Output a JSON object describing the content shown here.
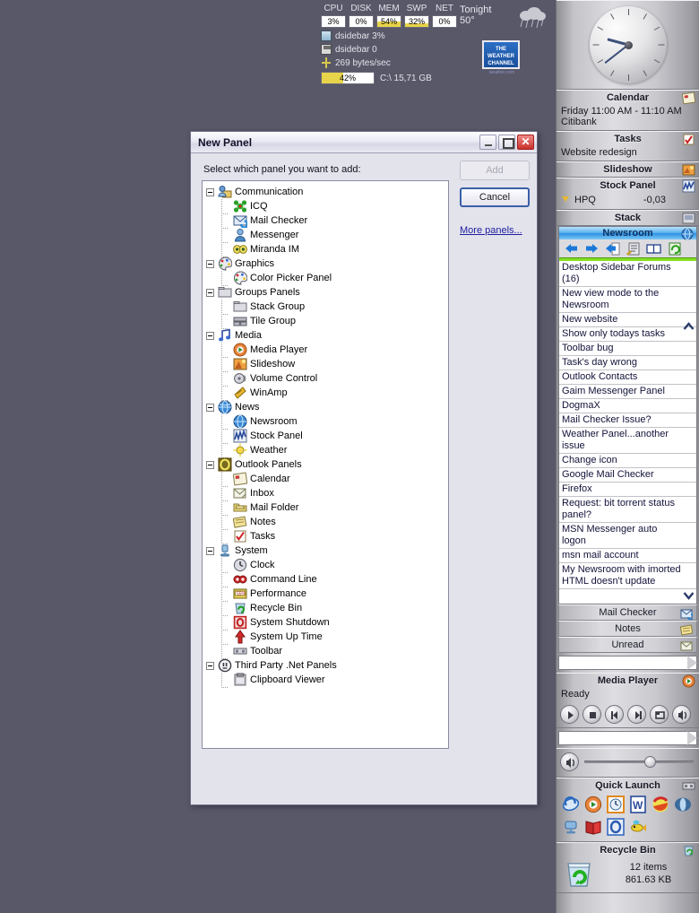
{
  "desktop": {
    "background": "#585869"
  },
  "sysmon": {
    "labels": [
      "CPU",
      "DISK",
      "MEM",
      "SWP",
      "NET"
    ],
    "values": [
      "3%",
      "0%",
      "54%",
      "32%",
      "0%"
    ],
    "fills": [
      0,
      0,
      54,
      32,
      0
    ],
    "cpu_process": "dsidebar 3%",
    "disk_process": "dsidebar 0",
    "net_rate": "269 bytes/sec",
    "drive_percent": "42%",
    "drive_fill": 42,
    "drive_label": "C:\\ 15,71 GB"
  },
  "weather": {
    "when": "Tonight",
    "temp": "50°",
    "brand_line1": "THE",
    "brand_line2": "WEATHER",
    "brand_line3": "CHANNEL",
    "brand_sub": "weather.com"
  },
  "dialog": {
    "title": "New Panel",
    "prompt": "Select which panel you want to add:",
    "buttons": {
      "add": "Add",
      "cancel": "Cancel",
      "more": "More panels..."
    },
    "window_controls": {
      "minimize": "minimize-button",
      "maximize": "maximize-button",
      "close": "✕"
    },
    "tree": [
      {
        "label": "Communication",
        "icon": "communication-icon",
        "group": true,
        "children": [
          {
            "label": "ICQ",
            "icon": "icq-icon"
          },
          {
            "label": "Mail Checker",
            "icon": "mail-checker-icon"
          },
          {
            "label": "Messenger",
            "icon": "messenger-icon"
          },
          {
            "label": "Miranda IM",
            "icon": "miranda-im-icon"
          }
        ]
      },
      {
        "label": "Graphics",
        "icon": "graphics-icon",
        "group": true,
        "children": [
          {
            "label": "Color Picker Panel",
            "icon": "color-picker-icon"
          }
        ]
      },
      {
        "label": "Groups Panels",
        "icon": "groups-icon",
        "group": true,
        "children": [
          {
            "label": "Stack Group",
            "icon": "stack-group-icon"
          },
          {
            "label": "Tile Group",
            "icon": "tile-group-icon"
          }
        ]
      },
      {
        "label": "Media",
        "icon": "media-icon",
        "group": true,
        "children": [
          {
            "label": "Media Player",
            "icon": "media-player-icon"
          },
          {
            "label": "Slideshow",
            "icon": "slideshow-icon"
          },
          {
            "label": "Volume Control",
            "icon": "volume-control-icon"
          },
          {
            "label": "WinAmp",
            "icon": "winamp-icon"
          }
        ]
      },
      {
        "label": "News",
        "icon": "news-icon",
        "group": true,
        "children": [
          {
            "label": "Newsroom",
            "icon": "newsroom-icon"
          },
          {
            "label": "Stock Panel",
            "icon": "stock-panel-icon"
          },
          {
            "label": "Weather",
            "icon": "weather-icon"
          }
        ]
      },
      {
        "label": "Outlook Panels",
        "icon": "outlook-icon",
        "group": true,
        "children": [
          {
            "label": "Calendar",
            "icon": "calendar-icon"
          },
          {
            "label": "Inbox",
            "icon": "inbox-icon"
          },
          {
            "label": "Mail Folder",
            "icon": "mail-folder-icon"
          },
          {
            "label": "Notes",
            "icon": "notes-icon"
          },
          {
            "label": "Tasks",
            "icon": "tasks-icon"
          }
        ]
      },
      {
        "label": "System",
        "icon": "system-icon",
        "group": true,
        "children": [
          {
            "label": "Clock",
            "icon": "clock-icon"
          },
          {
            "label": "Command Line",
            "icon": "command-line-icon"
          },
          {
            "label": "Performance",
            "icon": "performance-icon"
          },
          {
            "label": "Recycle Bin",
            "icon": "recycle-bin-icon"
          },
          {
            "label": "System Shutdown",
            "icon": "system-shutdown-icon"
          },
          {
            "label": "System Up Time",
            "icon": "system-uptime-icon"
          },
          {
            "label": "Toolbar",
            "icon": "toolbar-icon"
          }
        ]
      },
      {
        "label": "Third Party .Net Panels",
        "icon": "third-party-icon",
        "group": true,
        "children": [
          {
            "label": "Clipboard Viewer",
            "icon": "clipboard-viewer-icon"
          }
        ]
      }
    ]
  },
  "sidebar": {
    "clock": {
      "name": "Clock",
      "hour_angle": 285,
      "minute_angle": 232
    },
    "calendar": {
      "title": "Calendar",
      "line1": "Friday 11:00 AM - 11:10 AM",
      "line2": "Citibank"
    },
    "tasks": {
      "title": "Tasks",
      "item": "Website redesign"
    },
    "slideshow": {
      "title": "Slideshow"
    },
    "stock": {
      "title": "Stock Panel",
      "symbol": "HPQ",
      "change": "-0,03"
    },
    "stack": {
      "title": "Stack"
    },
    "newsroom": {
      "title": "Newsroom",
      "tools": [
        "back-icon",
        "forward-icon",
        "new-post-icon",
        "edit-icon",
        "read-icon",
        "refresh-icon"
      ],
      "items": [
        "Desktop Sidebar Forums (16)",
        "New view mode to the Newsroom",
        "New website",
        "Show only todays tasks",
        "Toolbar bug",
        "Task's day wrong",
        "Outlook Contacts",
        "Gaim Messenger Panel",
        "DogmaX",
        "Mail Checker Issue?",
        "Weather Panel...another issue",
        "Change icon",
        "Google Mail Checker",
        "Firefox",
        "Request: bit torrent status panel?",
        "MSN Messenger auto logon",
        "msn mail account",
        "My Newsroom with imorted HTML doesn't update"
      ],
      "buttons": [
        "Mail Checker",
        "Notes",
        "Unread"
      ]
    },
    "mediaplayer": {
      "title": "Media Player",
      "status": "Ready",
      "controls": [
        "play-button",
        "stop-button",
        "previous-button",
        "next-button",
        "repeat-button",
        "mute-button"
      ]
    },
    "quicklaunch": {
      "title": "Quick Launch",
      "icons": [
        "internet-explorer-icon",
        "media-player-icon",
        "clock-icon",
        "word-icon",
        "paint-icon",
        "opera-icon",
        "desktop-icon",
        "book-icon",
        "outlook-icon",
        "fish-icon"
      ]
    },
    "recyclebin": {
      "title": "Recycle Bin",
      "items": "12 items",
      "size": "861.63 KB"
    },
    "urlbar_value": "",
    "urlbar2_value": ""
  }
}
